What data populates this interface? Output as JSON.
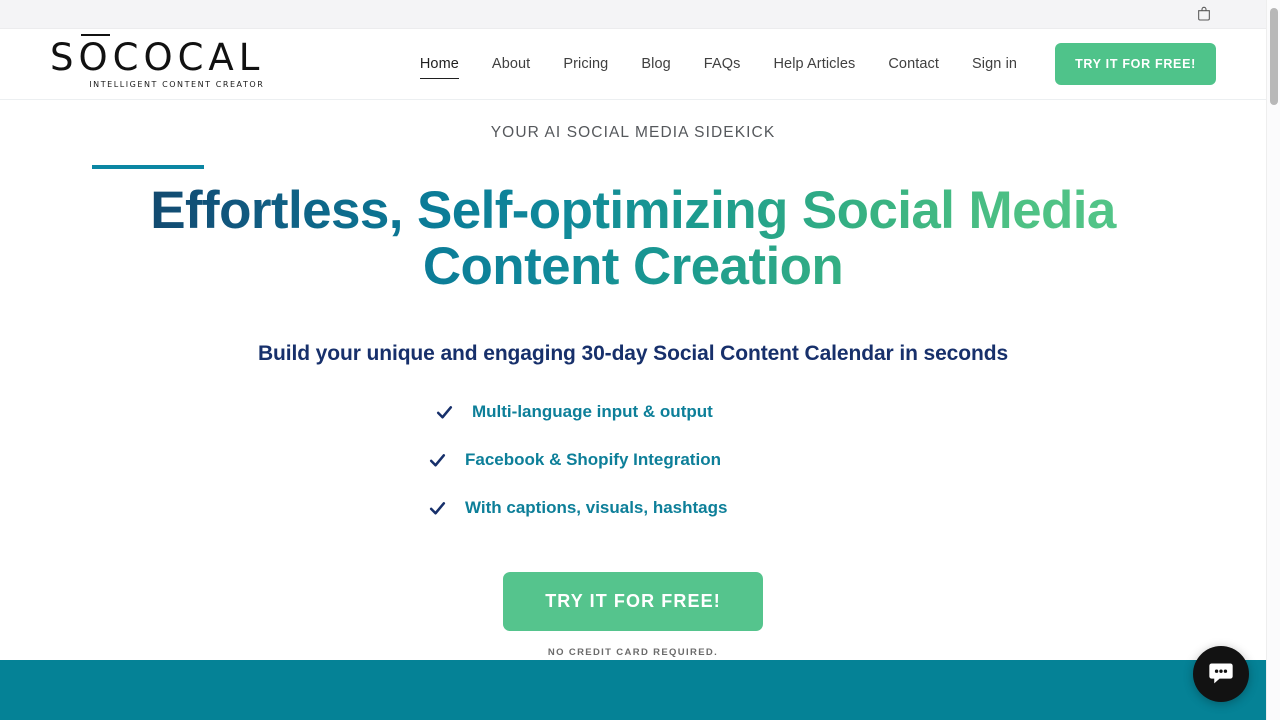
{
  "utility_bar": {
    "cart_icon": "shopping-bag-icon"
  },
  "header": {
    "brand": {
      "wordmark_part1": "S",
      "wordmark_o": "O",
      "wordmark_part2": "COCAL",
      "tagline": "INTELLIGENT CONTENT CREATOR"
    },
    "nav": [
      {
        "label": "Home",
        "active": true
      },
      {
        "label": "About",
        "active": false
      },
      {
        "label": "Pricing",
        "active": false
      },
      {
        "label": "Blog",
        "active": false
      },
      {
        "label": "FAQs",
        "active": false
      },
      {
        "label": "Help Articles",
        "active": false
      },
      {
        "label": "Contact",
        "active": false
      },
      {
        "label": "Sign in",
        "active": false
      }
    ],
    "cta_label": "TRY IT FOR FREE!"
  },
  "hero": {
    "eyebrow": "YOUR AI SOCIAL MEDIA SIDEKICK",
    "title": "Effortless, Self-optimizing Social Media Content Creation",
    "subtitle": "Build your unique and engaging 30-day Social Content Calendar in seconds",
    "features": [
      {
        "label": "Multi-language input & output",
        "icon": "check-icon"
      },
      {
        "label": "Facebook & Shopify Integration",
        "icon": "check-icon"
      },
      {
        "label": "With captions, visuals, hashtags",
        "icon": "check-icon"
      }
    ],
    "cta_label": "TRY IT FOR FREE!",
    "note": "NO CREDIT CARD REQUIRED."
  },
  "chat": {
    "icon": "chat-bubble-icon"
  },
  "colors": {
    "utility_bar_bg": "#f4f4f6",
    "green_cta": "#4fc38a",
    "hero_cta_green": "#55c48d",
    "teal_accent": "#0b86a3",
    "teal_band": "#058296",
    "navy_text": "#17306b",
    "feature_teal": "#0d7f99",
    "title_gradient_start": "#123f63",
    "title_gradient_end": "#56c88b"
  }
}
